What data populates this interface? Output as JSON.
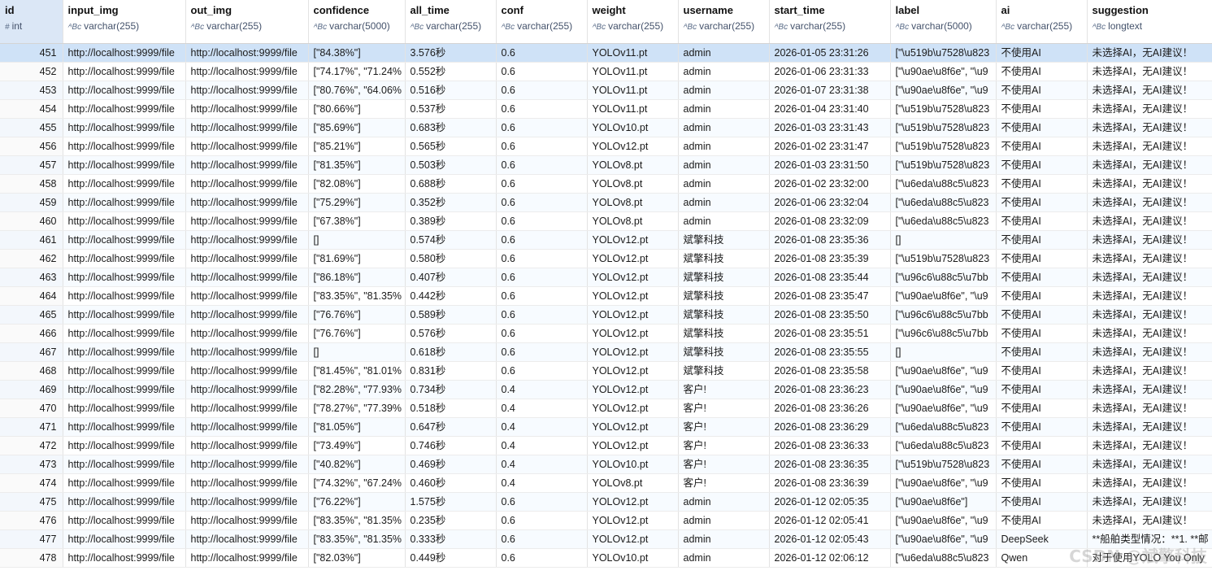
{
  "columns": [
    {
      "name": "id",
      "type": "int",
      "type_icon": "#"
    },
    {
      "name": "input_img",
      "type": "varchar(255)",
      "type_icon": "ᴬBc"
    },
    {
      "name": "out_img",
      "type": "varchar(255)",
      "type_icon": "ᴬBc"
    },
    {
      "name": "confidence",
      "type": "varchar(5000)",
      "type_icon": "ᴬBc"
    },
    {
      "name": "all_time",
      "type": "varchar(255)",
      "type_icon": "ᴬBc"
    },
    {
      "name": "conf",
      "type": "varchar(255)",
      "type_icon": "ᴬBc"
    },
    {
      "name": "weight",
      "type": "varchar(255)",
      "type_icon": "ᴬBc"
    },
    {
      "name": "username",
      "type": "varchar(255)",
      "type_icon": "ᴬBc"
    },
    {
      "name": "start_time",
      "type": "varchar(255)",
      "type_icon": "ᴬBc"
    },
    {
      "name": "label",
      "type": "varchar(5000)",
      "type_icon": "ᴬBc"
    },
    {
      "name": "ai",
      "type": "varchar(255)",
      "type_icon": "ᴬBc"
    },
    {
      "name": "suggestion",
      "type": "longtext",
      "type_icon": "ᴬBc"
    }
  ],
  "rows": [
    [
      "451",
      "http://localhost:9999/file",
      "http://localhost:9999/file",
      "[\"84.38%\"]",
      "3.576秒",
      "0.6",
      "YOLOv11.pt",
      "admin",
      "2026-01-05 23:31:26",
      "[\"\\u519b\\u7528\\u823",
      "不使用AI",
      "未选择AI，无AI建议！"
    ],
    [
      "452",
      "http://localhost:9999/file",
      "http://localhost:9999/file",
      "[\"74.17%\", \"71.24%",
      "0.552秒",
      "0.6",
      "YOLOv11.pt",
      "admin",
      "2026-01-06 23:31:33",
      "[\"\\u90ae\\u8f6e\", \"\\u9",
      "不使用AI",
      "未选择AI，无AI建议！"
    ],
    [
      "453",
      "http://localhost:9999/file",
      "http://localhost:9999/file",
      "[\"80.76%\", \"64.06%",
      "0.516秒",
      "0.6",
      "YOLOv11.pt",
      "admin",
      "2026-01-07 23:31:38",
      "[\"\\u90ae\\u8f6e\", \"\\u9",
      "不使用AI",
      "未选择AI，无AI建议！"
    ],
    [
      "454",
      "http://localhost:9999/file",
      "http://localhost:9999/file",
      "[\"80.66%\"]",
      "0.537秒",
      "0.6",
      "YOLOv11.pt",
      "admin",
      "2026-01-04 23:31:40",
      "[\"\\u519b\\u7528\\u823",
      "不使用AI",
      "未选择AI，无AI建议！"
    ],
    [
      "455",
      "http://localhost:9999/file",
      "http://localhost:9999/file",
      "[\"85.69%\"]",
      "0.683秒",
      "0.6",
      "YOLOv10.pt",
      "admin",
      "2026-01-03 23:31:43",
      "[\"\\u519b\\u7528\\u823",
      "不使用AI",
      "未选择AI，无AI建议！"
    ],
    [
      "456",
      "http://localhost:9999/file",
      "http://localhost:9999/file",
      "[\"85.21%\"]",
      "0.565秒",
      "0.6",
      "YOLOv12.pt",
      "admin",
      "2026-01-02 23:31:47",
      "[\"\\u519b\\u7528\\u823",
      "不使用AI",
      "未选择AI，无AI建议！"
    ],
    [
      "457",
      "http://localhost:9999/file",
      "http://localhost:9999/file",
      "[\"81.35%\"]",
      "0.503秒",
      "0.6",
      "YOLOv8.pt",
      "admin",
      "2026-01-03 23:31:50",
      "[\"\\u519b\\u7528\\u823",
      "不使用AI",
      "未选择AI，无AI建议！"
    ],
    [
      "458",
      "http://localhost:9999/file",
      "http://localhost:9999/file",
      "[\"82.08%\"]",
      "0.688秒",
      "0.6",
      "YOLOv8.pt",
      "admin",
      "2026-01-02 23:32:00",
      "[\"\\u6eda\\u88c5\\u823",
      "不使用AI",
      "未选择AI，无AI建议！"
    ],
    [
      "459",
      "http://localhost:9999/file",
      "http://localhost:9999/file",
      "[\"75.29%\"]",
      "0.352秒",
      "0.6",
      "YOLOv8.pt",
      "admin",
      "2026-01-06 23:32:04",
      "[\"\\u6eda\\u88c5\\u823",
      "不使用AI",
      "未选择AI，无AI建议！"
    ],
    [
      "460",
      "http://localhost:9999/file",
      "http://localhost:9999/file",
      "[\"67.38%\"]",
      "0.389秒",
      "0.6",
      "YOLOv8.pt",
      "admin",
      "2026-01-08 23:32:09",
      "[\"\\u6eda\\u88c5\\u823",
      "不使用AI",
      "未选择AI，无AI建议！"
    ],
    [
      "461",
      "http://localhost:9999/file",
      "http://localhost:9999/file",
      "[]",
      "0.574秒",
      "0.6",
      "YOLOv12.pt",
      "斌擎科技",
      "2026-01-08 23:35:36",
      "[]",
      "不使用AI",
      "未选择AI，无AI建议！"
    ],
    [
      "462",
      "http://localhost:9999/file",
      "http://localhost:9999/file",
      "[\"81.69%\"]",
      "0.580秒",
      "0.6",
      "YOLOv12.pt",
      "斌擎科技",
      "2026-01-08 23:35:39",
      "[\"\\u519b\\u7528\\u823",
      "不使用AI",
      "未选择AI，无AI建议！"
    ],
    [
      "463",
      "http://localhost:9999/file",
      "http://localhost:9999/file",
      "[\"86.18%\"]",
      "0.407秒",
      "0.6",
      "YOLOv12.pt",
      "斌擎科技",
      "2026-01-08 23:35:44",
      "[\"\\u96c6\\u88c5\\u7bb",
      "不使用AI",
      "未选择AI，无AI建议！"
    ],
    [
      "464",
      "http://localhost:9999/file",
      "http://localhost:9999/file",
      "[\"83.35%\", \"81.35%",
      "0.442秒",
      "0.6",
      "YOLOv12.pt",
      "斌擎科技",
      "2026-01-08 23:35:47",
      "[\"\\u90ae\\u8f6e\", \"\\u9",
      "不使用AI",
      "未选择AI，无AI建议！"
    ],
    [
      "465",
      "http://localhost:9999/file",
      "http://localhost:9999/file",
      "[\"76.76%\"]",
      "0.589秒",
      "0.6",
      "YOLOv12.pt",
      "斌擎科技",
      "2026-01-08 23:35:50",
      "[\"\\u96c6\\u88c5\\u7bb",
      "不使用AI",
      "未选择AI，无AI建议！"
    ],
    [
      "466",
      "http://localhost:9999/file",
      "http://localhost:9999/file",
      "[\"76.76%\"]",
      "0.576秒",
      "0.6",
      "YOLOv12.pt",
      "斌擎科技",
      "2026-01-08 23:35:51",
      "[\"\\u96c6\\u88c5\\u7bb",
      "不使用AI",
      "未选择AI，无AI建议！"
    ],
    [
      "467",
      "http://localhost:9999/file",
      "http://localhost:9999/file",
      "[]",
      "0.618秒",
      "0.6",
      "YOLOv12.pt",
      "斌擎科技",
      "2026-01-08 23:35:55",
      "[]",
      "不使用AI",
      "未选择AI，无AI建议！"
    ],
    [
      "468",
      "http://localhost:9999/file",
      "http://localhost:9999/file",
      "[\"81.45%\", \"81.01%",
      "0.831秒",
      "0.6",
      "YOLOv12.pt",
      "斌擎科技",
      "2026-01-08 23:35:58",
      "[\"\\u90ae\\u8f6e\", \"\\u9",
      "不使用AI",
      "未选择AI，无AI建议！"
    ],
    [
      "469",
      "http://localhost:9999/file",
      "http://localhost:9999/file",
      "[\"82.28%\", \"77.93%",
      "0.734秒",
      "0.4",
      "YOLOv12.pt",
      "客户!",
      "2026-01-08 23:36:23",
      "[\"\\u90ae\\u8f6e\", \"\\u9",
      "不使用AI",
      "未选择AI，无AI建议！"
    ],
    [
      "470",
      "http://localhost:9999/file",
      "http://localhost:9999/file",
      "[\"78.27%\", \"77.39%",
      "0.518秒",
      "0.4",
      "YOLOv12.pt",
      "客户!",
      "2026-01-08 23:36:26",
      "[\"\\u90ae\\u8f6e\", \"\\u9",
      "不使用AI",
      "未选择AI，无AI建议！"
    ],
    [
      "471",
      "http://localhost:9999/file",
      "http://localhost:9999/file",
      "[\"81.05%\"]",
      "0.647秒",
      "0.4",
      "YOLOv12.pt",
      "客户!",
      "2026-01-08 23:36:29",
      "[\"\\u6eda\\u88c5\\u823",
      "不使用AI",
      "未选择AI，无AI建议！"
    ],
    [
      "472",
      "http://localhost:9999/file",
      "http://localhost:9999/file",
      "[\"73.49%\"]",
      "0.746秒",
      "0.4",
      "YOLOv12.pt",
      "客户!",
      "2026-01-08 23:36:33",
      "[\"\\u6eda\\u88c5\\u823",
      "不使用AI",
      "未选择AI，无AI建议！"
    ],
    [
      "473",
      "http://localhost:9999/file",
      "http://localhost:9999/file",
      "[\"40.82%\"]",
      "0.469秒",
      "0.4",
      "YOLOv10.pt",
      "客户!",
      "2026-01-08 23:36:35",
      "[\"\\u519b\\u7528\\u823",
      "不使用AI",
      "未选择AI，无AI建议！"
    ],
    [
      "474",
      "http://localhost:9999/file",
      "http://localhost:9999/file",
      "[\"74.32%\", \"67.24%",
      "0.460秒",
      "0.4",
      "YOLOv8.pt",
      "客户!",
      "2026-01-08 23:36:39",
      "[\"\\u90ae\\u8f6e\", \"\\u9",
      "不使用AI",
      "未选择AI，无AI建议！"
    ],
    [
      "475",
      "http://localhost:9999/file",
      "http://localhost:9999/file",
      "[\"76.22%\"]",
      "1.575秒",
      "0.6",
      "YOLOv12.pt",
      "admin",
      "2026-01-12 02:05:35",
      "[\"\\u90ae\\u8f6e\"]",
      "不使用AI",
      "未选择AI，无AI建议！"
    ],
    [
      "476",
      "http://localhost:9999/file",
      "http://localhost:9999/file",
      "[\"83.35%\", \"81.35%",
      "0.235秒",
      "0.6",
      "YOLOv12.pt",
      "admin",
      "2026-01-12 02:05:41",
      "[\"\\u90ae\\u8f6e\", \"\\u9",
      "不使用AI",
      "未选择AI，无AI建议！"
    ],
    [
      "477",
      "http://localhost:9999/file",
      "http://localhost:9999/file",
      "[\"83.35%\", \"81.35%",
      "0.333秒",
      "0.6",
      "YOLOv12.pt",
      "admin",
      "2026-01-12 02:05:43",
      "[\"\\u90ae\\u8f6e\", \"\\u9",
      "DeepSeek",
      "**船舶类型情况：**1. **邮"
    ],
    [
      "478",
      "http://localhost:9999/file",
      "http://localhost:9999/file",
      "[\"82.03%\"]",
      "0.449秒",
      "0.6",
      "YOLOv10.pt",
      "admin",
      "2026-01-12 02:06:12",
      "[\"\\u6eda\\u88c5\\u823",
      "Qwen",
      "对于使用YOLO You Only"
    ]
  ],
  "selected_row": 0,
  "watermark": "CSDN @斌擎科技"
}
